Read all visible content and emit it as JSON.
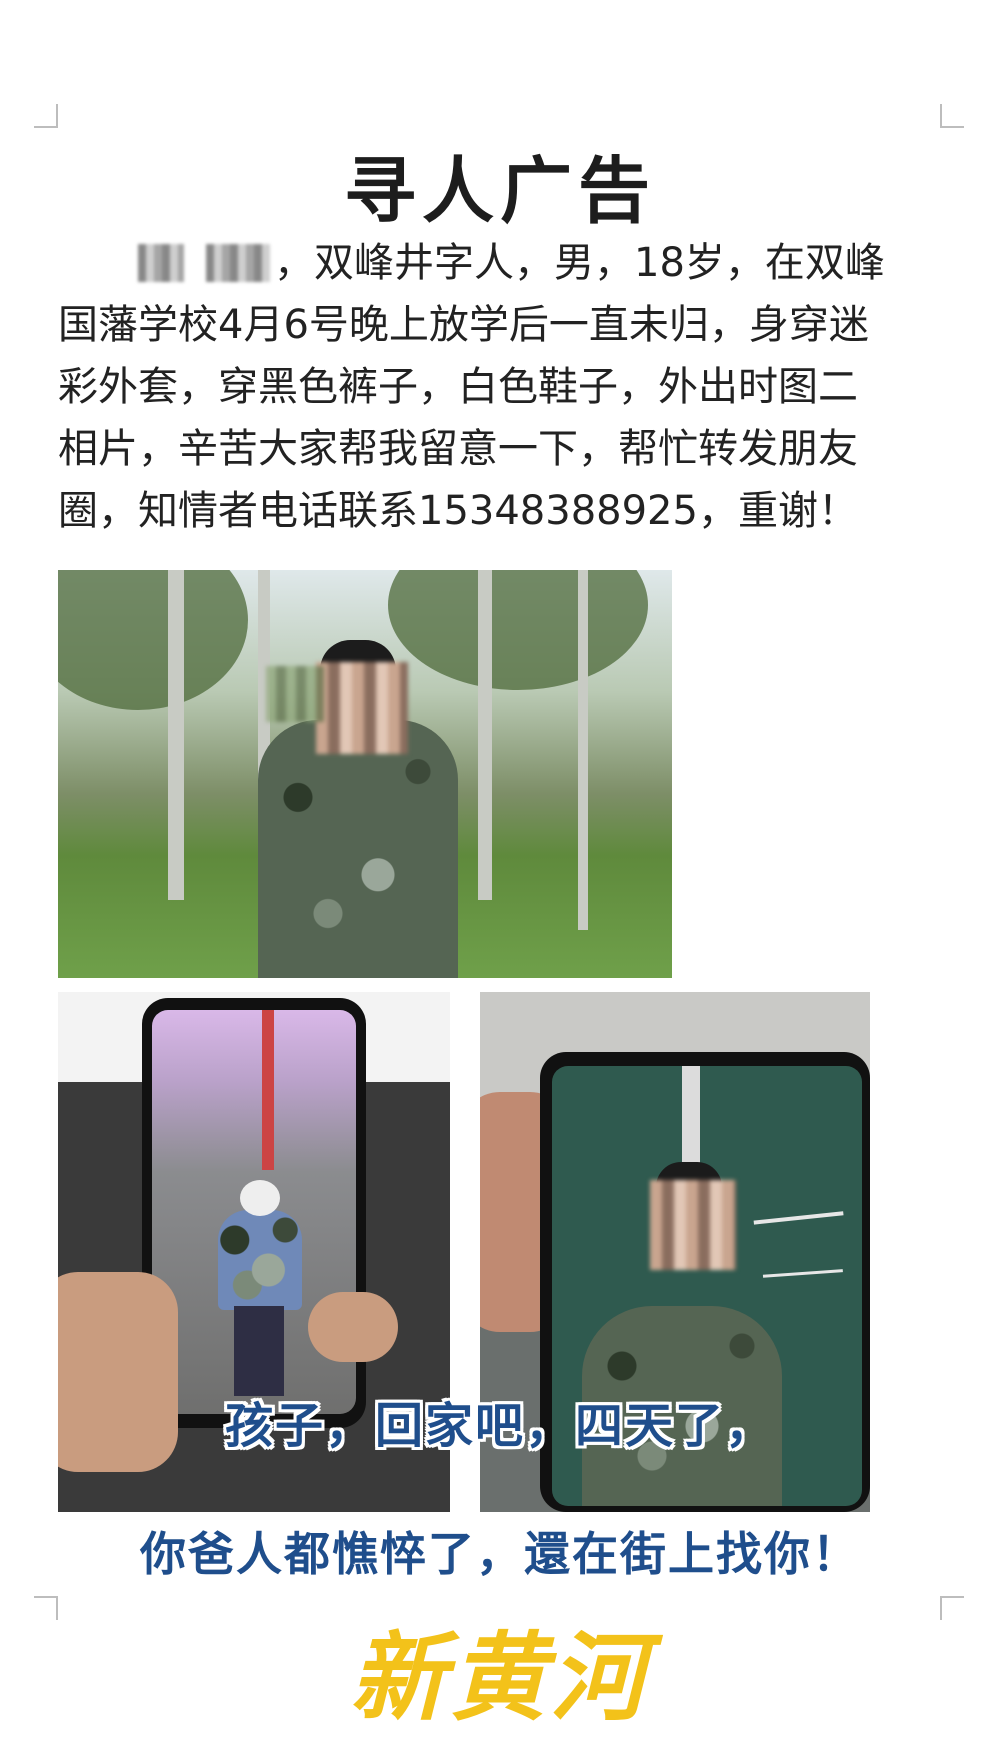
{
  "title": "寻人广告",
  "body_lines": [
    "，双峰井字人，男，18岁，在双峰",
    "国藩学校4月6号晚上放学后一直未归，身穿迷",
    "彩外套，穿黑色裤子，白色鞋子，外出时图二",
    "相片，辛苦大家帮我留意一下，帮忙转发朋友",
    "圈，知情者电话联系15348388925，重谢！"
  ],
  "captions": {
    "line1": "孩子，回家吧，四天了，",
    "line2": "你爸人都憔悴了，還在街上找你！"
  },
  "logo_text": "新黄河",
  "colors": {
    "caption": "#1f4e8c",
    "logo": "#f3c21a"
  }
}
